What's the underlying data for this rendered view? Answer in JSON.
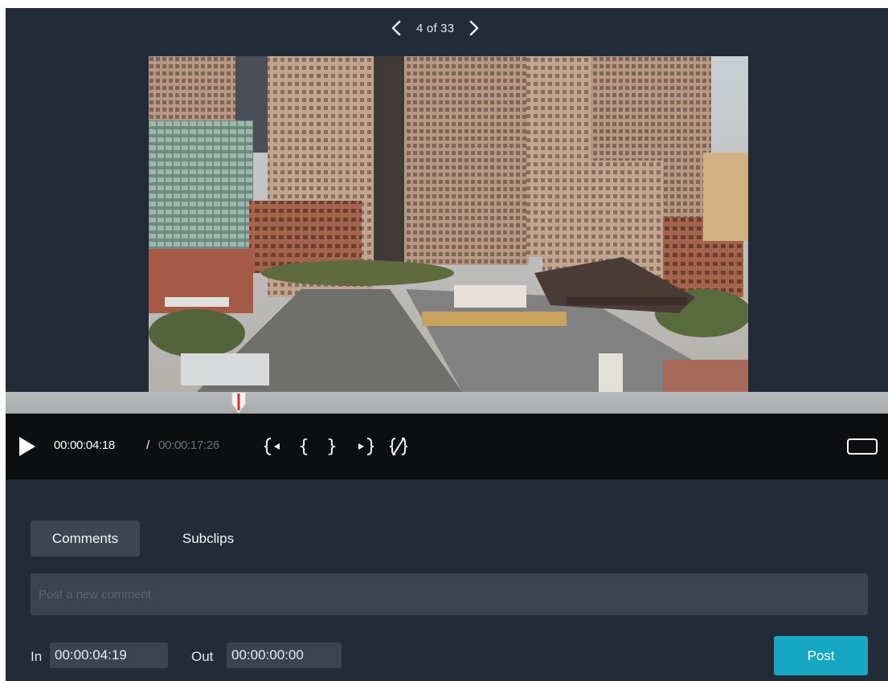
{
  "viewer": {
    "counter": "4 of 33",
    "prev_icon": "chevron-left-icon",
    "next_icon": "chevron-right-icon"
  },
  "media": {
    "playhead_progress": 0.264
  },
  "controls": {
    "play_icon": "play-icon",
    "current_time": "00:00:04:18",
    "separator": "/",
    "duration": "00:00:17:26",
    "mark_in_icon": "go-to-in-point-icon",
    "set_in_label": "{",
    "set_out_label": "}",
    "mark_out_icon": "go-to-out-point-icon",
    "clear_marks_icon": "clear-in-out-icon",
    "aspect_icon": "aspect-ratio-icon"
  },
  "tabs": [
    {
      "label": "Comments",
      "active": true
    },
    {
      "label": "Subclips",
      "active": false
    }
  ],
  "comment": {
    "placeholder": "Post a new comment",
    "value": ""
  },
  "range": {
    "in_label": "In",
    "in_value": "00:00:04:19",
    "out_label": "Out",
    "out_value": "00:00:00:00"
  },
  "post_label": "Post",
  "colors": {
    "background": "#222c38",
    "control_bar": "#0d0e10",
    "accent": "#16a7c4",
    "playhead": "#e32b2b"
  }
}
